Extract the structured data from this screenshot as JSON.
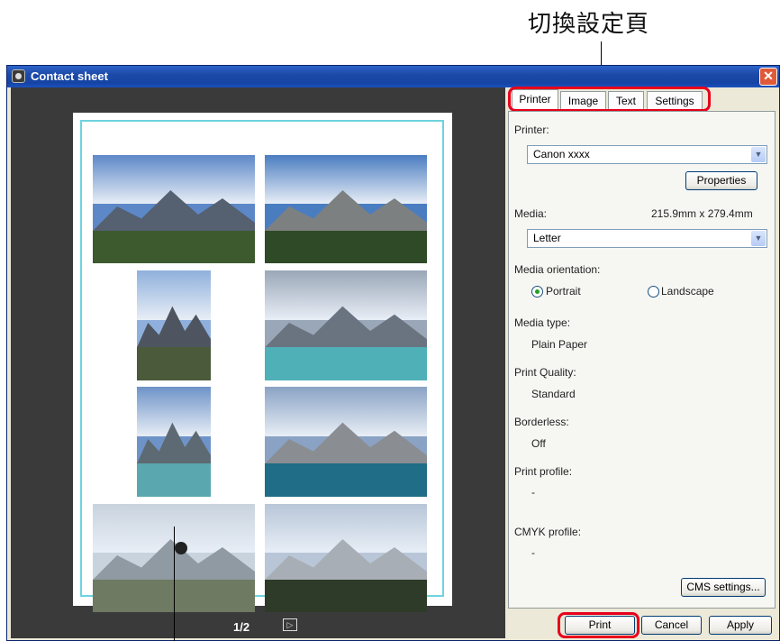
{
  "callout": {
    "title": "切換設定頁"
  },
  "window": {
    "title": "Contact sheet",
    "close_glyph": "✕"
  },
  "preview": {
    "page_indicator": "1/2",
    "next_glyph": "▷",
    "thumbnails": [
      {
        "sky": "#5d88c8",
        "mtn": "#556070",
        "ground": "#3c5a2e"
      },
      {
        "sky": "#4a7dc0",
        "mtn": "#7d8080",
        "ground": "#2f4a27"
      },
      {
        "sky": "#8fb0dc",
        "mtn": "#4e5560",
        "ground": "#4a5a3a"
      },
      {
        "sky": "#9aa7b8",
        "mtn": "#6a7480",
        "ground": "#4fb0b8"
      },
      {
        "sky": "#6e93c8",
        "mtn": "#5d6a73",
        "ground": "#5aa7b0"
      },
      {
        "sky": "#8aa3c4",
        "mtn": "#8a8d92",
        "ground": "#1f6d86"
      },
      {
        "sky": "#c9d3de",
        "mtn": "#8f9aa3",
        "ground": "#6e7a62"
      },
      {
        "sky": "#b8c6d8",
        "mtn": "#a8aeb5",
        "ground": "#2d3b28"
      }
    ]
  },
  "tabs": [
    {
      "label": "Printer",
      "active": true
    },
    {
      "label": "Image",
      "active": false
    },
    {
      "label": "Text",
      "active": false
    },
    {
      "label": "Settings",
      "active": false
    }
  ],
  "printer": {
    "printer_label": "Printer:",
    "printer_value": "Canon xxxx",
    "properties_button": "Properties",
    "media_label": "Media:",
    "media_size": "215.9mm x 279.4mm",
    "media_value": "Letter",
    "orientation_label": "Media orientation:",
    "portrait_label": "Portrait",
    "landscape_label": "Landscape",
    "media_type_label": "Media type:",
    "media_type_value": "Plain Paper",
    "quality_label": "Print Quality:",
    "quality_value": "Standard",
    "borderless_label": "Borderless:",
    "borderless_value": "Off",
    "print_profile_label": "Print profile:",
    "print_profile_value": "-",
    "cmyk_label": "CMYK profile:",
    "cmyk_value": "-",
    "cms_button": "CMS settings..."
  },
  "footer": {
    "print": "Print",
    "cancel": "Cancel",
    "apply": "Apply"
  },
  "icons": {
    "dropdown": "chevron-down-icon",
    "close": "close-icon",
    "next": "next-page-icon"
  }
}
